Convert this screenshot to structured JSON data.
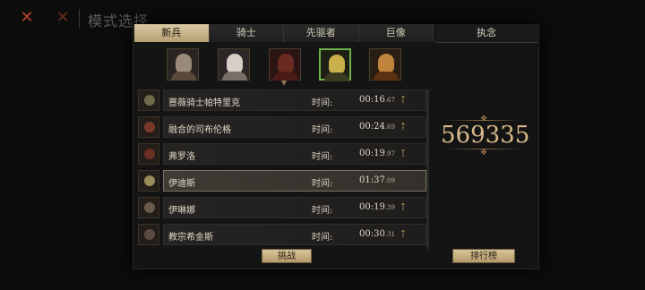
{
  "background": {
    "title": "模式选择"
  },
  "tabs": [
    {
      "label": "新兵",
      "active": true
    },
    {
      "label": "骑士",
      "active": false
    },
    {
      "label": "先驱者",
      "active": false
    },
    {
      "label": "巨像",
      "active": false
    }
  ],
  "right_panel": {
    "tab_label": "执念",
    "score": "569335"
  },
  "portraits": [
    {
      "icon": "old-man-portrait-icon"
    },
    {
      "icon": "white-hair-woman-portrait-icon"
    },
    {
      "icon": "red-hood-portrait-icon"
    },
    {
      "icon": "golden-mask-portrait-icon",
      "selected": true
    },
    {
      "icon": "blonde-warrior-portrait-icon"
    }
  ],
  "rows": [
    {
      "name": "蔷薇骑士帕特里克",
      "time_label": "时间:",
      "time": "00:16",
      "ms": ".67"
    },
    {
      "name": "融合的司布伦格",
      "time_label": "时间:",
      "time": "00:24",
      "ms": ".69"
    },
    {
      "name": "弗罗洛",
      "time_label": "时间:",
      "time": "00:19",
      "ms": ".97"
    },
    {
      "name": "伊迪斯",
      "time_label": "时间:",
      "time": "01:37",
      "ms": ".09",
      "selected": true
    },
    {
      "name": "伊琳娜",
      "time_label": "时间:",
      "time": "00:19",
      "ms": ".39"
    },
    {
      "name": "教宗希金斯",
      "time_label": "时间:",
      "time": "00:30",
      "ms": ".31"
    }
  ],
  "buttons": {
    "challenge": "挑战",
    "leaderboard": "排行榜"
  },
  "colors": {
    "accent": "#d7b98a",
    "tab_active": "#cbb68a",
    "selected_border": "#6fb24c"
  }
}
